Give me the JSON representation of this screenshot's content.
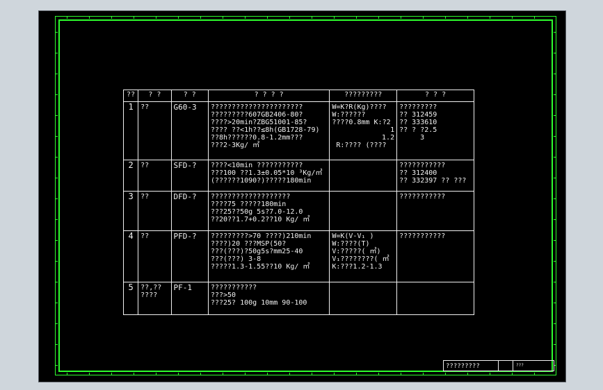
{
  "table": {
    "headers": [
      "??",
      "? ?",
      "? ?",
      "? ? ? ?",
      "?????????",
      "? ? ?"
    ],
    "rows": [
      {
        "no": "1",
        "name": [
          "??"
        ],
        "model": "G60-3",
        "requirements": [
          "??????????????????????",
          "?????????607GB2406-80?",
          "????>20min?ZBG51001-85?",
          "????  ??<1h??≤8h(GB1728-79)",
          "??8h??????0.8-1.2mm???",
          "???2-3Kg/ ㎡"
        ],
        "formula": [
          "W=K?R(Kg)????",
          "W:??????",
          "????0.8mm  K:?2",
          "1",
          "1.2",
          "R:????  (????"
        ],
        "factory": [
          "?????????",
          "??  312459",
          "??  333610",
          "?? ?  ?2.5",
          "3"
        ]
      },
      {
        "no": "2",
        "name": [
          "??"
        ],
        "model": "SFD-?",
        "requirements": [
          "????<10min  ???????????",
          "???100  ??1.3±0.05*10 ³Kg/㎡",
          "(??????1090?)?????180min"
        ],
        "formula": [],
        "factory": [
          "???????????",
          "??  312400",
          "??  332397  ??  ???"
        ]
      },
      {
        "no": "3",
        "name": [
          "??"
        ],
        "model": "DFD-?",
        "requirements": [
          "???????????????????",
          "????75  ?????180min",
          "???25??50g  5s?7.0-12.0",
          "??20??1.7+0.2??10  Kg/ ㎡"
        ],
        "formula": [],
        "factory": [
          "???????????"
        ]
      },
      {
        "no": "4",
        "name": [
          "??"
        ],
        "model": "PFD-?",
        "requirements": [
          "?????????>70  ????)210min",
          "????)20  ???MSP(50?",
          "???(???)?50g5s?mm25-40",
          "???(???)  3-8",
          "?????1.3-1.55??10  Kg/ ㎡"
        ],
        "formula": [
          "W=K(V-V₁ )",
          "W:????(T)",
          "V:?????( ㎡)",
          "V₁????????( ㎡",
          "K:???1.2-1.3"
        ],
        "factory": [
          "???????????"
        ]
      },
      {
        "no": "5",
        "name": [
          "??,??",
          "????"
        ],
        "model": "PF-1",
        "requirements": [
          "???????????",
          "???>50",
          "???25?  100g  10mm  90-100"
        ],
        "formula": [],
        "factory": []
      }
    ]
  },
  "title_block": {
    "name": "?????????",
    "code": "???"
  }
}
